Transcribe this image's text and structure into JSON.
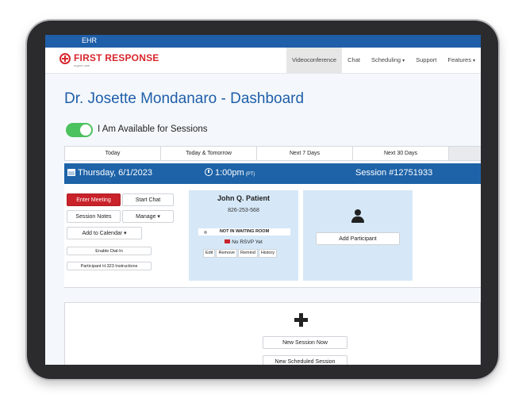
{
  "app": {
    "bar_label": "EHR"
  },
  "brand": {
    "name": "FIRST RESPONSE",
    "tagline": "urgent care"
  },
  "nav": {
    "items": [
      {
        "label": "Videoconference",
        "caret": false,
        "active": true
      },
      {
        "label": "Chat",
        "caret": false,
        "active": false
      },
      {
        "label": "Scheduling",
        "caret": true,
        "active": false
      },
      {
        "label": "Support",
        "caret": false,
        "active": false
      },
      {
        "label": "Features",
        "caret": true,
        "active": false
      }
    ]
  },
  "page": {
    "title": "Dr. Josette Mondanaro - Dashboard"
  },
  "availability": {
    "label": "I Am Available for Sessions",
    "on": true
  },
  "tabs": [
    "Today",
    "Today & Tomorrow",
    "Next 7 Days",
    "Next 30 Days"
  ],
  "session": {
    "date": "Thursday, 6/1/2023",
    "time": "1:00pm",
    "tz": "(PT)",
    "number": "Session #12751933",
    "buttons": {
      "enter_meeting": "Enter Meeting",
      "start_chat": "Start Chat",
      "session_notes": "Session Notes",
      "manage": "Manage",
      "add_to_calendar": "Add to Calendar",
      "enable_dial_in": "Enable Dial-In",
      "h323": "Participant H.323 Instructions"
    }
  },
  "participant": {
    "name": "John Q. Patient",
    "phone": "826-253-568",
    "status": "NOT IN WAITING ROOM",
    "rsvp": "No RSVP Yet",
    "actions": [
      "Edit",
      "Remove",
      "Remind",
      "History"
    ]
  },
  "add_participant": {
    "label": "Add Participant"
  },
  "new_session": {
    "now_label": "New Session Now",
    "scheduled_label": "New Scheduled Session"
  },
  "colors": {
    "brand_red": "#d7262d",
    "primary_blue": "#1e63a8",
    "toggle_green": "#4cc25e",
    "card_blue": "#d6e8f8"
  }
}
